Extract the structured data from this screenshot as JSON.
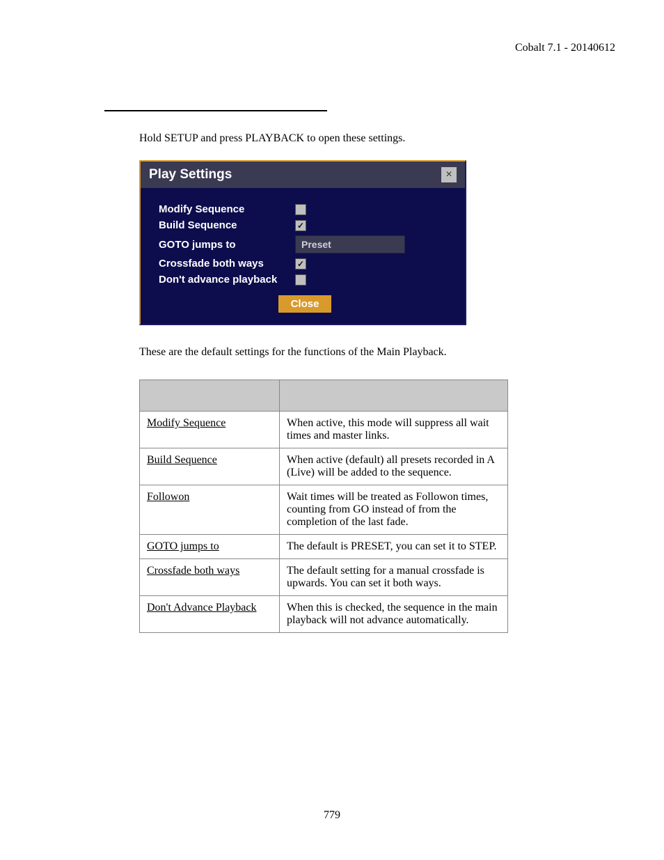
{
  "header": {
    "version": "Cobalt 7.1 - 20140612"
  },
  "intro": "Hold SETUP and press PLAYBACK to open these settings.",
  "dialog": {
    "title": "Play Settings",
    "close_x": "×",
    "rows": {
      "modify": {
        "label": "Modify Sequence",
        "checked": false
      },
      "build": {
        "label": "Build Sequence",
        "checked": true
      },
      "goto": {
        "label": "GOTO jumps to",
        "value": "Preset"
      },
      "crossfade": {
        "label": "Crossfade both ways",
        "checked": true
      },
      "dontadvance": {
        "label": "Don't advance playback",
        "checked": false
      }
    },
    "close_button": "Close"
  },
  "after": "These are the default settings for the functions of the Main Playback.",
  "table": {
    "rows": [
      {
        "name": "Modify Sequence",
        "desc": "When active, this mode will suppress all wait times and master links."
      },
      {
        "name": "Build Sequence",
        "desc": "When active (default) all presets recorded in A (Live) will be added to the sequence."
      },
      {
        "name": "Followon",
        "desc": "Wait times will be treated as Followon times, counting from GO instead of from the completion of the last fade."
      },
      {
        "name": "GOTO jumps to",
        "desc": "The default is PRESET, you can set it to STEP."
      },
      {
        "name": "Crossfade both ways",
        "desc": "The default setting for a manual crossfade is upwards. You can set it both ways."
      },
      {
        "name": "Don't Advance Playback",
        "desc": "When this is checked, the sequence in the main playback will not advance automatically."
      }
    ]
  },
  "page_number": "779"
}
